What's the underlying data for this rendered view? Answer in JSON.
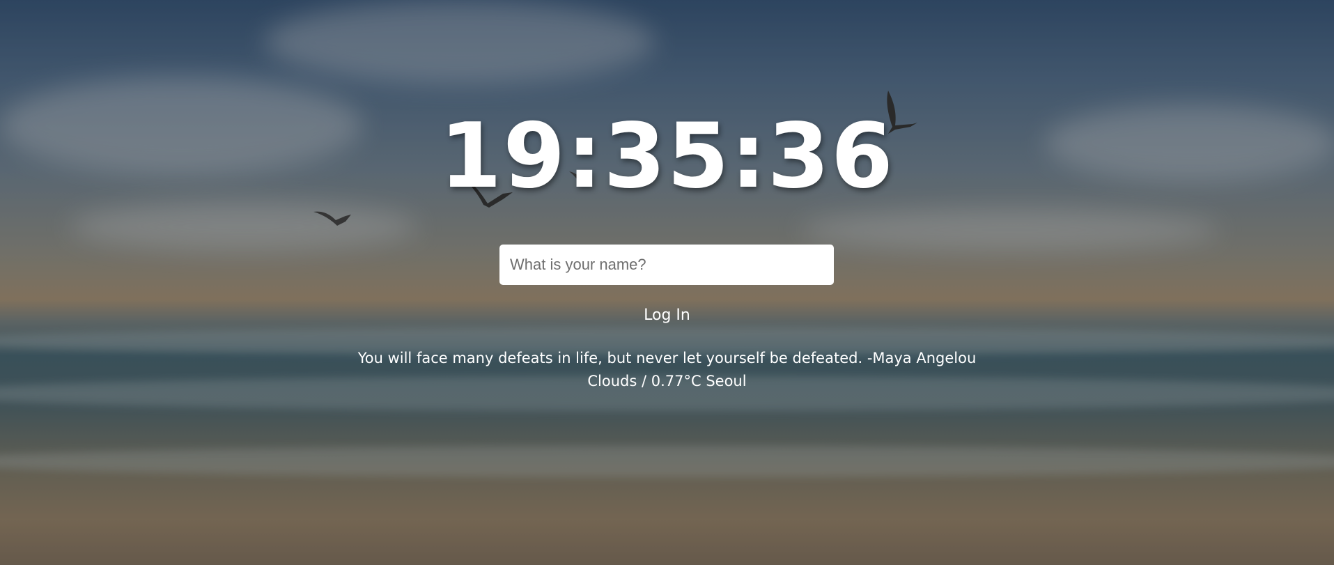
{
  "clock": {
    "time": "19:35:36"
  },
  "login": {
    "name_placeholder": "What is your name?",
    "name_value": "",
    "button_label": "Log In"
  },
  "quote": {
    "text": "You will face many defeats in life, but never let yourself be defeated.",
    "author": "-Maya Angelou"
  },
  "weather": {
    "summary": "Clouds / 0.77°C Seoul"
  },
  "background": {
    "scene": "beach-sunset-with-seagulls",
    "icons": [
      "seagull-icon"
    ]
  },
  "colors": {
    "text": "#ffffff",
    "input_background": "#ffffff",
    "placeholder": "#6e6e6e"
  }
}
